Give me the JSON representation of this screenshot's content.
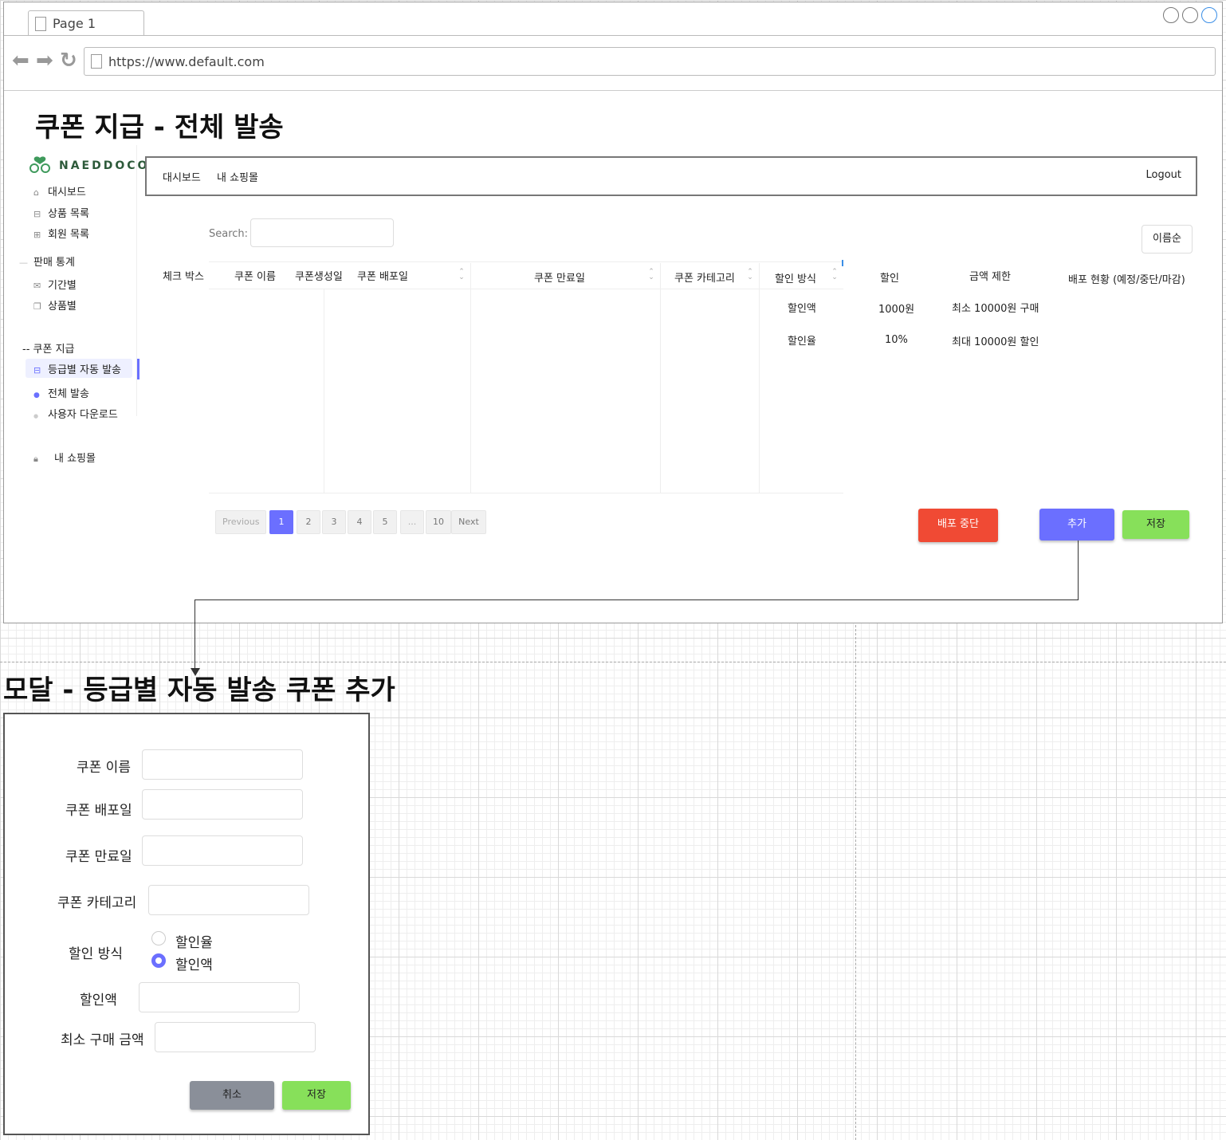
{
  "browser": {
    "tab_label": "Page 1",
    "url": "https://www.default.com"
  },
  "page_title": "쿠폰 지급 - 전체 발송",
  "sidebar": {
    "brand": "NAEDDOCO",
    "items": [
      {
        "label": "대시보드",
        "icon": "home-icon"
      },
      {
        "label": "상품 목록",
        "icon": "box-icon"
      },
      {
        "label": "회원 목록",
        "icon": "users-icon"
      }
    ],
    "section_stats": "판매 통계",
    "stats_items": [
      {
        "label": "기간별",
        "icon": "mail-icon"
      },
      {
        "label": "상품별",
        "icon": "copy-icon"
      }
    ],
    "section_coupon": "-- 쿠폰 지급",
    "coupon_items": [
      {
        "label": "등급별 자동 발송"
      },
      {
        "label": "전체 발송"
      },
      {
        "label": "사용자 다운로드"
      }
    ],
    "my_shop": "내 쇼핑몰"
  },
  "topnav": {
    "dashboard": "대시보드",
    "my_shop": "내 쇼핑몰",
    "logout": "Logout"
  },
  "search": {
    "label": "Search:",
    "value": ""
  },
  "sort_button": "이름순",
  "table": {
    "headers": [
      "체크 박스",
      "쿠폰 이름",
      "쿠폰생성일",
      "쿠폰 배포일",
      "쿠폰 만료일",
      "쿠폰 카테고리",
      "할인 방식",
      "할인",
      "금액 제한",
      "배포 현황 (예정/중단/마감)"
    ],
    "rows": [
      [
        "할인액",
        "1000원",
        "최소 10000원 구매"
      ],
      [
        "할인율",
        "10%",
        "최대 10000원 할인"
      ]
    ]
  },
  "pagination": [
    "Previous",
    "1",
    "2",
    "3",
    "4",
    "5",
    "...",
    "10",
    "Next"
  ],
  "actions": {
    "stop": "배포 중단",
    "add": "추가",
    "save": "저장"
  },
  "colors": {
    "stop": "#f04a34",
    "add": "#6b6fff",
    "save": "#87e05a",
    "cancel": "#8a8f99"
  },
  "modal": {
    "title": "모달 - 등급별 자동 발송 쿠폰 추가",
    "fields": {
      "name": "쿠폰 이름",
      "dist_date": "쿠폰 배포일",
      "exp_date": "쿠폰 만료일",
      "category": "쿠폰 카테고리",
      "discount_type": "할인 방식",
      "amount": "할인액",
      "min_purchase": "최소 구매 금액"
    },
    "radio_options": [
      "할인율",
      "할인액"
    ],
    "radio_selected": "할인액",
    "cancel": "취소",
    "save": "저장"
  }
}
